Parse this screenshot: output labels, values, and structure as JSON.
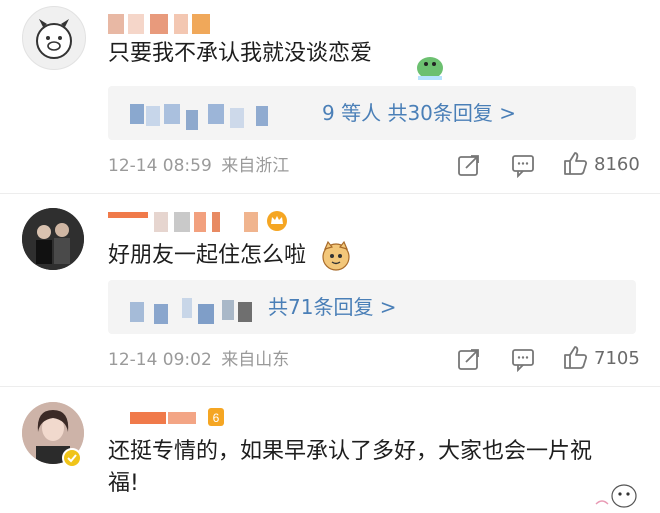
{
  "comments": [
    {
      "text": "只要我不承认我就没谈恋爱",
      "reply_summary": "9 等人  共30条回复 >",
      "time": "12-14 08:59",
      "location": "来自浙江",
      "likes": "8160",
      "sticker": "dinosaur-sticker"
    },
    {
      "text": "好朋友一起住怎么啦",
      "reply_summary": "共71条回复 >",
      "time": "12-14 09:02",
      "location": "来自山东",
      "likes": "7105",
      "sticker": "cat-emoji"
    },
    {
      "text_line1": "还挺专情的，如果早承认了多好，大家也会一片祝",
      "text_line2": "福!",
      "sticker": "cartoon-sticker"
    }
  ],
  "colors": {
    "link": "#4a7fb7",
    "meta": "#9a9a9a",
    "reply_bg": "#f4f4f4",
    "vip_badge": "#f5a623",
    "verified_badge": "#f0c419"
  }
}
